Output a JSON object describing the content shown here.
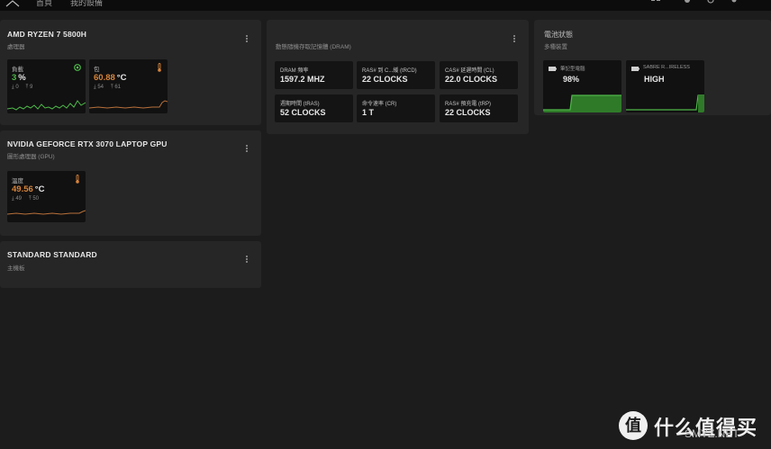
{
  "nav": {
    "items": [
      "首頁",
      "我的設備"
    ]
  },
  "cpu": {
    "title": "AMD RYZEN 7 5800H",
    "subtitle": "處理器",
    "load": {
      "label": "負載",
      "value": "3",
      "unit": "%",
      "min": "0",
      "max": "9",
      "color": "#4fb84a"
    },
    "package": {
      "label": "包",
      "value": "60.88",
      "unit": "°C",
      "min": "54",
      "max": "61",
      "color": "#d8843a"
    }
  },
  "gpu": {
    "title": "NVIDIA GEFORCE RTX 3070 LAPTOP GPU",
    "subtitle": "圖形處理器 (GPU)",
    "temp": {
      "label": "溫度",
      "value": "49.56",
      "unit": "°C",
      "min": "49",
      "max": "50",
      "color": "#d8843a"
    }
  },
  "board": {
    "title": "STANDARD STANDARD",
    "subtitle": "主機板"
  },
  "dram": {
    "subtitle": "動態隨機存取記憶體 (DRAM)",
    "tiles": [
      {
        "label": "DRAM 頻率",
        "value": "1597.2 MHZ"
      },
      {
        "label": "RAS# 到 C...緩 (tRCD)",
        "value": "22 CLOCKS"
      },
      {
        "label": "CAS# 延遲時間 (CL)",
        "value": "22.0 CLOCKS"
      },
      {
        "label": "週期時間 (tRAS)",
        "value": "52 CLOCKS"
      },
      {
        "label": "命令速率 (CR)",
        "value": "1 T"
      },
      {
        "label": "RAS# 預充電 (tRP)",
        "value": "22 CLOCKS"
      }
    ]
  },
  "battery": {
    "title": "電池狀態",
    "subtitle": "多種裝置",
    "tiles": [
      {
        "label": "筆記型電腦",
        "value": "98%",
        "color": "#4fb84a"
      },
      {
        "label": "SABRE R...IRELESS",
        "value": "HIGH",
        "color": "#4fb84a"
      }
    ]
  },
  "watermark": {
    "text": "什么值得买",
    "site": "SMYZ.NET"
  }
}
